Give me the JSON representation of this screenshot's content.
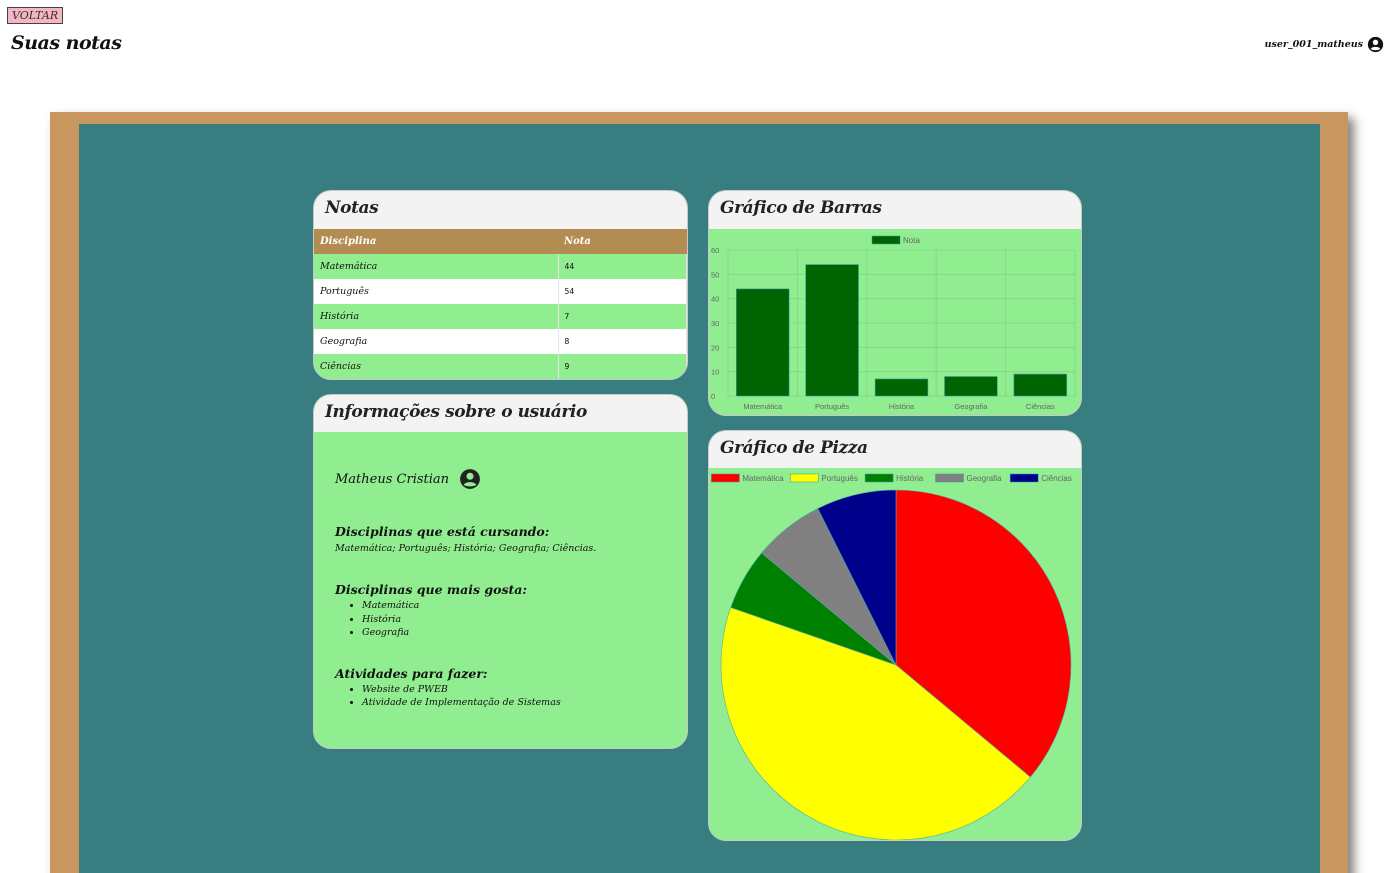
{
  "header": {
    "back_label": "VOLTAR",
    "title": "Suas notas",
    "username": "user_001_matheus"
  },
  "grades_card": {
    "title": "Notas",
    "columns": [
      "Disciplina",
      "Nota"
    ],
    "rows": [
      {
        "subject": "Matemática",
        "grade": "44"
      },
      {
        "subject": "Português",
        "grade": "54"
      },
      {
        "subject": "História",
        "grade": "7"
      },
      {
        "subject": "Geografia",
        "grade": "8"
      },
      {
        "subject": "Ciências",
        "grade": "9"
      }
    ]
  },
  "info_card": {
    "title": "Informações sobre o usuário",
    "name": "Matheus Cristian",
    "studying_heading": "Disciplinas que está cursando:",
    "studying_text": "Matemática; Português; História; Geografia; Ciências.",
    "favorites_heading": "Disciplinas que mais gosta:",
    "favorites": [
      "Matemática",
      "História",
      "Geografia"
    ],
    "todo_heading": "Atividades para fazer:",
    "todo": [
      "Website de PWEB",
      "Atividade de Implementação de Sistemas"
    ]
  },
  "bar_card": {
    "title": "Gráfico de Barras"
  },
  "pie_card": {
    "title": "Gráfico de Pizza"
  },
  "colors": {
    "board_frame": "#c8965f",
    "board": "#387d7f",
    "card_bg": "#90ed90",
    "table_header": "#b38c52",
    "bar": "#006400"
  },
  "chart_data": [
    {
      "type": "bar",
      "categories": [
        "Matemática",
        "Português",
        "História",
        "Geografia",
        "Ciências"
      ],
      "series": [
        {
          "name": "Nota",
          "values": [
            44,
            54,
            7,
            8,
            9
          ],
          "color": "#006400"
        }
      ],
      "ylim": [
        0,
        60
      ],
      "yticks": [
        0,
        10,
        20,
        30,
        40,
        50,
        60
      ],
      "grid": true,
      "legend": "top"
    },
    {
      "type": "pie",
      "labels": [
        "Matemática",
        "Português",
        "História",
        "Geografia",
        "Ciências"
      ],
      "values": [
        44,
        54,
        7,
        8,
        9
      ],
      "colors": [
        "#ff0000",
        "#ffff00",
        "#008000",
        "#808080",
        "#00008b"
      ],
      "legend": "top"
    }
  ]
}
